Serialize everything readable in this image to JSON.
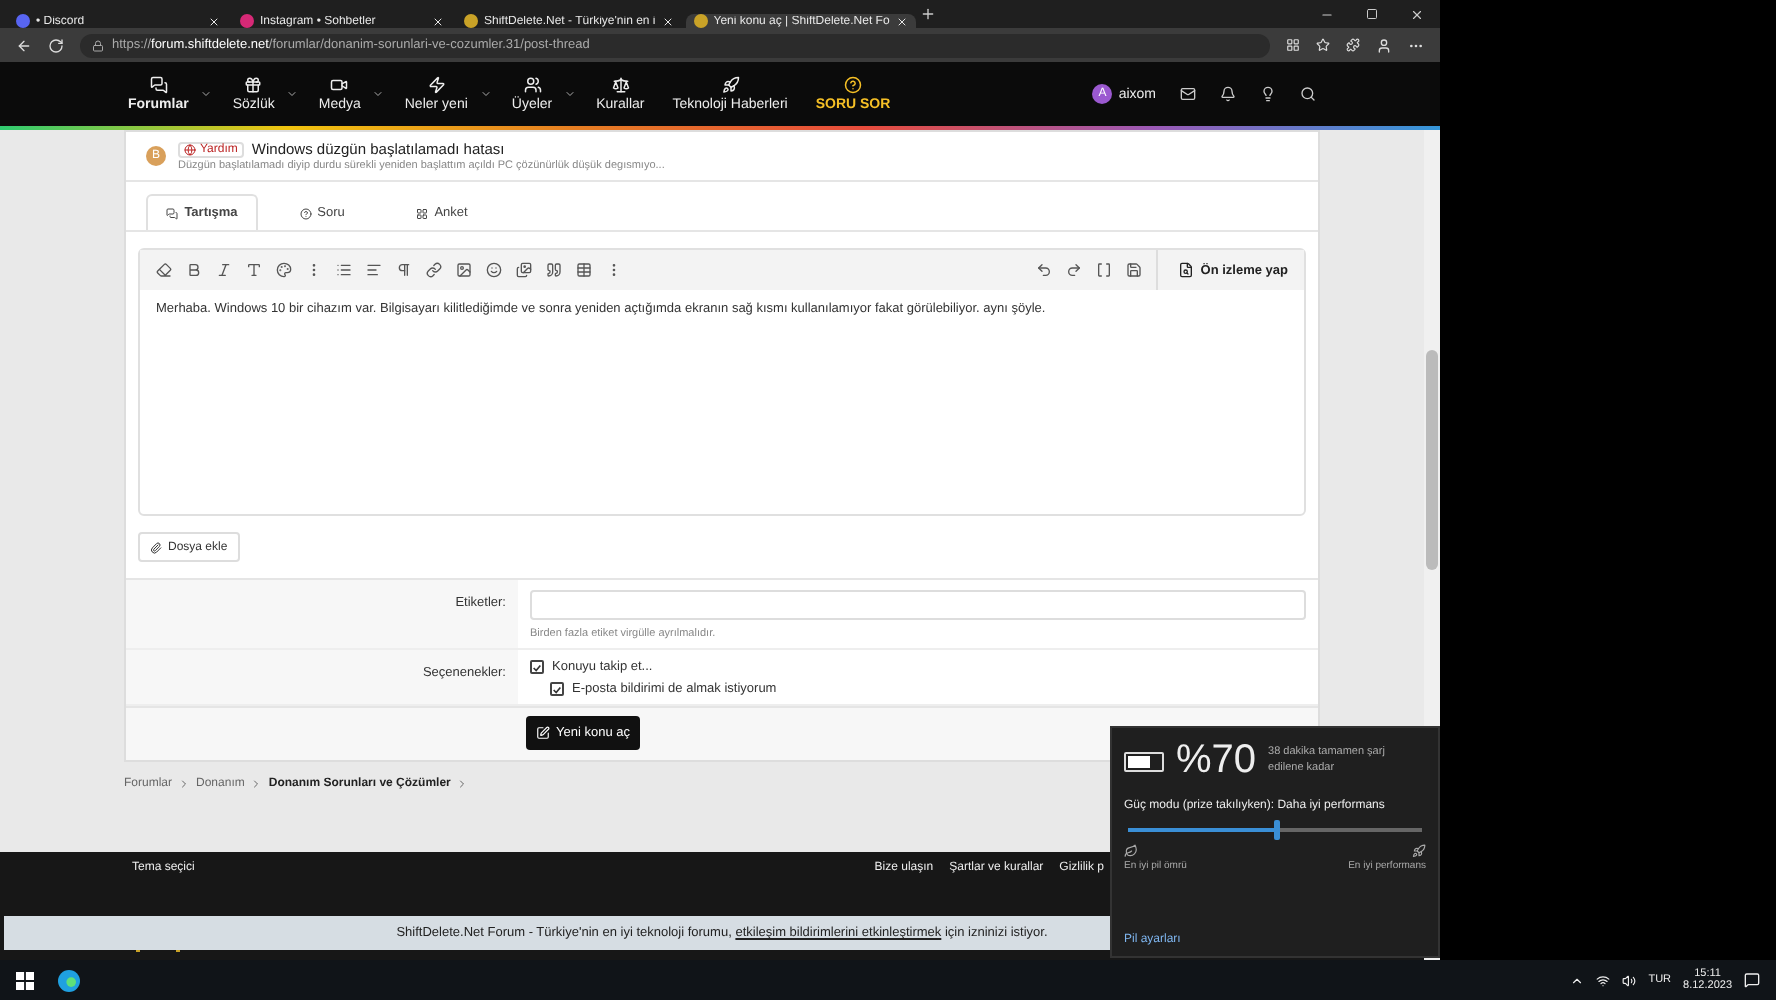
{
  "browser_tabs": [
    {
      "title": "• Discord",
      "selected": false
    },
    {
      "title": "Instagram • Sohbetler",
      "selected": false
    },
    {
      "title": "ShiftDelete.Net - Türkiye'nin en i",
      "selected": false
    },
    {
      "title": "Yeni konu aç | ShiftDelete.Net Fo",
      "selected": true
    }
  ],
  "address_bar": {
    "url": "https://**forum.shiftdelete.net**/forumlar/donanim-sorunlari-ve-cozumler.31/post-thread"
  },
  "site_nav": {
    "items": [
      {
        "label": "Forumlar",
        "dropdown": true,
        "selected": true,
        "kind": "normal"
      },
      {
        "label": "Sözlük",
        "dropdown": true,
        "selected": false,
        "kind": "normal"
      },
      {
        "label": "Medya",
        "dropdown": true,
        "selected": false,
        "kind": "normal"
      },
      {
        "label": "Neler yeni",
        "dropdown": true,
        "selected": false,
        "kind": "normal"
      },
      {
        "label": "Üyeler",
        "dropdown": true,
        "selected": false,
        "kind": "normal"
      },
      {
        "label": "Kurallar",
        "dropdown": false,
        "selected": false,
        "kind": "normal"
      },
      {
        "label": "Teknoloji Haberleri",
        "dropdown": false,
        "selected": false,
        "kind": "normal"
      },
      {
        "label": "SORU SOR",
        "dropdown": false,
        "selected": false,
        "kind": "highlight"
      }
    ],
    "user": {
      "initial": "A",
      "name": "aixom"
    }
  },
  "thread_preview": {
    "avatar_initial": "B",
    "prefix": "Yardım",
    "title": "Windows düzgün başlatılamadı hatası",
    "snippet": "Düzgün başlatılamadı diyip durdu sürekli yeniden başlattım açıldı PC çözünürlük düşük degısmıyo..."
  },
  "editor_tabs": [
    {
      "label": "Tartışma",
      "selected": true
    },
    {
      "label": "Soru",
      "selected": false
    },
    {
      "label": "Anket",
      "selected": false
    }
  ],
  "editor": {
    "preview_button": "Ön izleme yap",
    "content": "Merhaba. Windows 10 bir cihazım var. Bilgisayarı kilitlediğimde ve sonra yeniden açtığımda ekranın sağ kısmı kullanılamıyor fakat görülebiliyor. aynı şöyle."
  },
  "attach_button": "Dosya ekle",
  "tags_field": {
    "label": "Etiketler:",
    "hint": "Birden fazla etiket virgülle ayrılmalıdır."
  },
  "options": {
    "label": "Seçenenekler:",
    "items": [
      {
        "label": "Konuyu takip et...",
        "checked": true,
        "children": [
          {
            "label": "E-posta bildirimi de almak istiyorum",
            "checked": true
          }
        ]
      }
    ]
  },
  "submit_button": "Yeni konu aç",
  "breadcrumb": [
    {
      "label": "Forumlar",
      "current": false
    },
    {
      "label": "Donanım",
      "current": false
    },
    {
      "label": "Donanım Sorunları ve Çözümler",
      "current": true
    }
  ],
  "footer": {
    "theme_label": "Tema seçici",
    "links": [
      "Bize ulaşın",
      "Şartlar ve kurallar",
      "Gizlilik p"
    ]
  },
  "notification_bar": {
    "text": "ShiftDelete.Net Forum - Türkiye'nin en iyi teknoloji forumu,",
    "link": "etkileşim bildirimlerini etkinleştirmek",
    "suffix": "için izninizi istiyor."
  },
  "battery_flyout": {
    "battery": {
      "level": 0.7
    },
    "percent": "%70",
    "estimate": "38 dakika tamamen şarj edilene kadar",
    "power_mode": "Güç modu (prize takılıyken): Daha iyi performans",
    "power_slider": {
      "level": 0.5
    },
    "left_label": "En iyi pil ömrü",
    "right_label": "En iyi performans",
    "settings_link": "Pil ayarları"
  },
  "taskbar": {
    "language": "TUR",
    "time": "15:11",
    "date": "8.12.2023"
  }
}
